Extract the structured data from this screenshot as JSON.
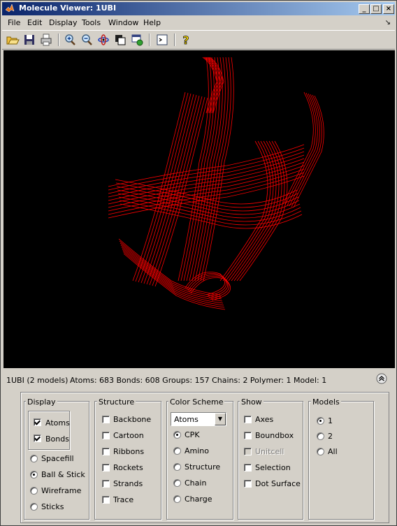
{
  "window": {
    "title": "Molecule Viewer: 1UBI"
  },
  "menu": {
    "items": [
      "File",
      "Edit",
      "Display",
      "Tools",
      "Window",
      "Help"
    ],
    "dock_arrow": "↘"
  },
  "toolbar": {
    "buttons": [
      "open-icon",
      "save-icon",
      "print-icon",
      "zoom-in-icon",
      "zoom-out-icon",
      "rotate-icon",
      "copy-figure-icon",
      "link-icon",
      "console-icon",
      "help-icon"
    ],
    "help_glyph": "?"
  },
  "status": {
    "model_text": "1UBI (2 models)",
    "info_text": "Atoms: 683  Bonds: 608  Groups: 157  Chains: 2  Polymer: 1  Model: 1"
  },
  "display": {
    "label": "Display",
    "atoms_label": "Atoms",
    "atoms_checked": true,
    "bonds_label": "Bonds",
    "bonds_checked": true,
    "modes": [
      "Spacefill",
      "Ball & Stick",
      "Wireframe",
      "Sticks"
    ],
    "selected_mode": "Ball & Stick"
  },
  "structure": {
    "label": "Structure",
    "items": [
      "Backbone",
      "Cartoon",
      "Ribbons",
      "Rockets",
      "Strands",
      "Trace"
    ]
  },
  "color_scheme": {
    "label": "Color Scheme",
    "selected_target": "Atoms",
    "options": [
      "CPK",
      "Amino",
      "Structure",
      "Chain",
      "Charge"
    ],
    "selected_option": "CPK"
  },
  "show": {
    "label": "Show",
    "items": [
      "Axes",
      "Boundbox",
      "Unitcell",
      "Selection",
      "Dot Surface"
    ],
    "disabled": "Unitcell"
  },
  "models": {
    "label": "Models",
    "options": [
      "1",
      "2",
      "All"
    ],
    "selected": "1"
  },
  "colors": {
    "ribbon": "#ff0000",
    "viewer_bg": "#000000",
    "titlebar": "#0a246a"
  }
}
